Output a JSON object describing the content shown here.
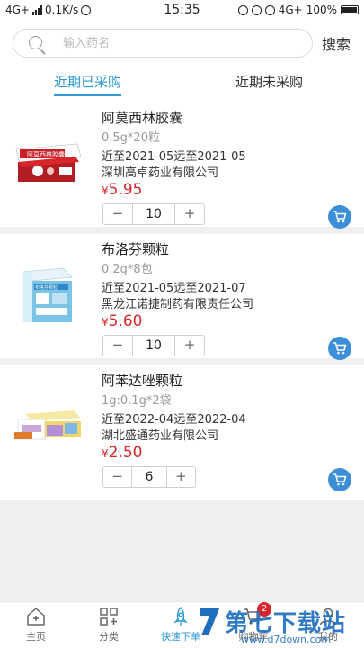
{
  "status_bar": {
    "network": "4G+",
    "speed": "0.1K/s",
    "time": "15:35",
    "right_network": "4G+",
    "battery": "100%"
  },
  "search": {
    "placeholder": "输入药名",
    "value": "",
    "button_label": "搜索"
  },
  "tabs": [
    {
      "label": "近期已采购",
      "active": true
    },
    {
      "label": "近期未采购",
      "active": false
    }
  ],
  "products": [
    {
      "name": "阿莫西林胶囊",
      "spec": "0.5g*20粒",
      "expiry": "近至2021-05远至2021-05",
      "company": "深圳高卓药业有限公司",
      "currency": "¥",
      "price": "5.95",
      "quantity": "10",
      "minus": "−",
      "plus": "+",
      "box_text": "阿莫西林胶囊"
    },
    {
      "name": "布洛芬颗粒",
      "spec": "0.2g*8包",
      "expiry": "近至2021-05远至2021-07",
      "company": "黑龙江诺捷制药有限责任公司",
      "currency": "¥",
      "price": "5.60",
      "quantity": "10",
      "minus": "−",
      "plus": "+",
      "box_text": "布洛芬颗粒"
    },
    {
      "name": "阿苯达唑颗粒",
      "spec": "1g:0.1g*2袋",
      "expiry": "近至2022-04远至2022-04",
      "company": "湖北盛通药业有限公司",
      "currency": "¥",
      "price": "2.50",
      "quantity": "6",
      "minus": "−",
      "plus": "+",
      "box_text": ""
    }
  ],
  "bottom_nav": [
    {
      "label": "主页",
      "icon": "home-icon",
      "active": false
    },
    {
      "label": "分类",
      "icon": "grid-icon",
      "active": false
    },
    {
      "label": "快速下单",
      "icon": "rocket-icon",
      "active": true
    },
    {
      "label": "购物车",
      "icon": "cart-icon",
      "active": false,
      "badge": "2"
    },
    {
      "label": "我的",
      "icon": "user-icon",
      "active": false
    }
  ],
  "watermark": {
    "main": "第七下载站",
    "sub": "www.d7down.com"
  },
  "colors": {
    "accent": "#2d9ad6",
    "price": "#d6252c",
    "cart_button": "#3a8fd8"
  }
}
